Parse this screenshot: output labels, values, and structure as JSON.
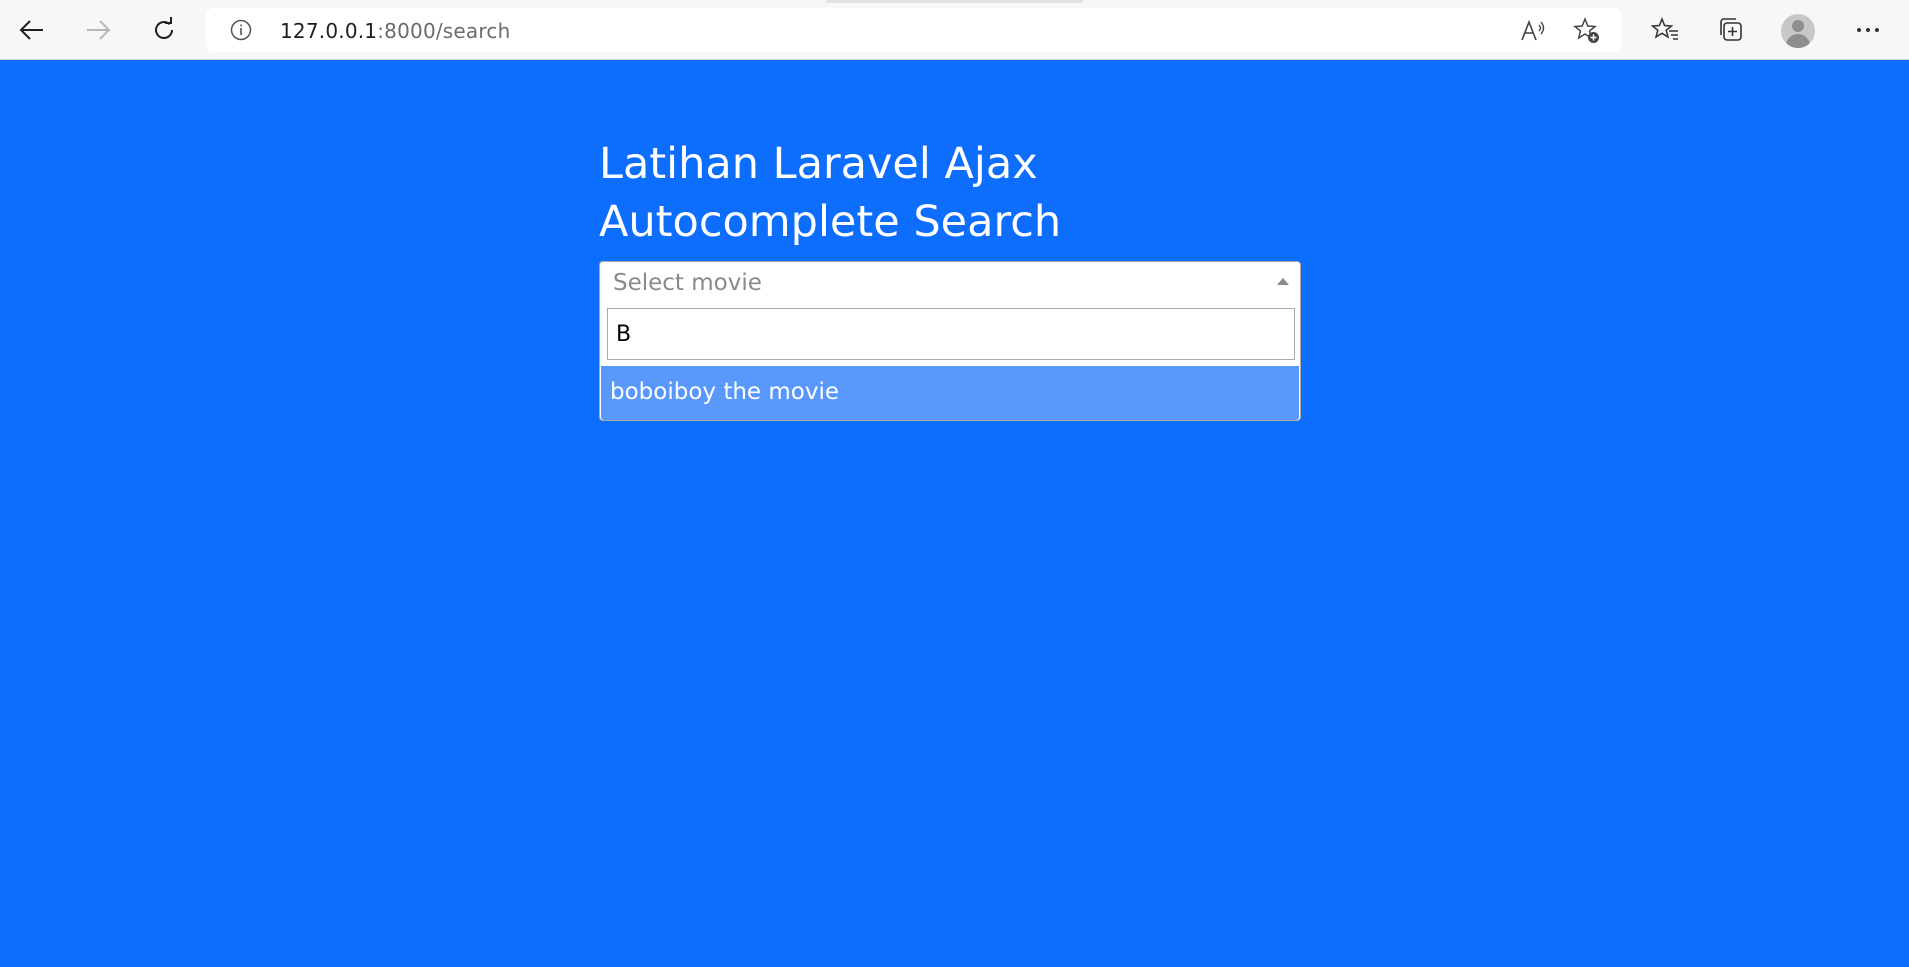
{
  "browser": {
    "url_host": "127.0.0.1",
    "url_rest": ":8000/search",
    "icons": {
      "back": "back-arrow-icon",
      "forward": "forward-arrow-icon",
      "refresh": "refresh-icon",
      "info": "info-icon",
      "read_aloud": "read-aloud-icon",
      "add_favorite": "add-favorite-icon",
      "favorites": "favorites-icon",
      "collections": "collections-icon",
      "profile": "profile-avatar",
      "more": "more-options-icon"
    }
  },
  "page": {
    "background": "#0d6efd",
    "title": "Latihan Laravel Ajax Autocomplete Search",
    "select": {
      "placeholder": "Select movie",
      "search_value": "B",
      "results": [
        {
          "label": "boboiboy the movie",
          "highlighted": true
        }
      ],
      "highlight_color": "#5897fb"
    }
  }
}
